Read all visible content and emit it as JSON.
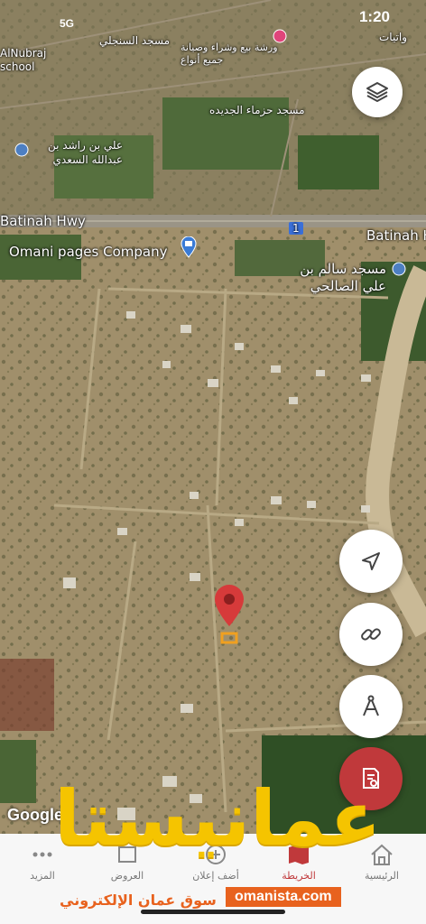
{
  "status_bar": {
    "time": "1:20",
    "network": "5G"
  },
  "map": {
    "labels": {
      "mosque_sanjeli": "مسجد السنجلي",
      "workshop": "ورشة بيع وشراء وصيانة جميع أنواع",
      "wattayat": "واتيات",
      "school": "AlNubraj school",
      "mosque_hazma": "مسجد حزماء الجديده",
      "ali_bin_rashid": "علي بن راشد بن عبدالله السعدي",
      "batinah_hwy_left": "Batinah Hwy",
      "batinah_hwy_right": "Batinah H",
      "omani_pages": "Omani pages Company",
      "mosque_salim": "مسجد سالم بن علي الصالحي",
      "road_number": "1"
    },
    "attribution": "Google"
  },
  "controls": {
    "layers": "layers-icon",
    "locate": "navigation-arrow-icon",
    "share": "link-icon",
    "measure": "compass-icon",
    "report": "document-search-icon"
  },
  "tabbar": {
    "home": "الرئيسية",
    "map": "الخريطة",
    "add": "أضف إعلان",
    "offers": "العروض",
    "more": "المزيد"
  },
  "branding": {
    "logo_text": "عمانيستا",
    "tagline": "سوق عمان الإلكتروني",
    "url": "omanista.com"
  }
}
